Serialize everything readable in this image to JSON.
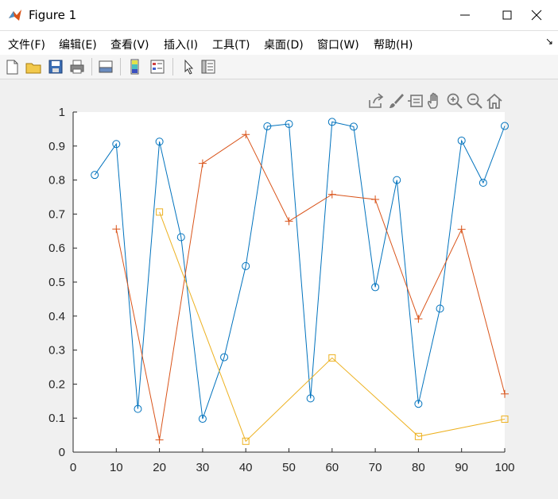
{
  "window": {
    "title": "Figure 1"
  },
  "menu": [
    "文件(F)",
    "编辑(E)",
    "查看(V)",
    "插入(I)",
    "工具(T)",
    "桌面(D)",
    "窗口(W)",
    "帮助(H)"
  ],
  "toolbar": [
    "new-figure-icon",
    "open-folder-icon",
    "save-icon",
    "print-icon",
    "link-plot-icon",
    "colorbar-icon",
    "legend-icon",
    "pointer-icon",
    "property-inspector-icon"
  ],
  "axes_toolbar": [
    "export-icon",
    "brush-icon",
    "data-tips-icon",
    "pan-icon",
    "zoom-in-icon",
    "zoom-out-icon",
    "home-icon"
  ],
  "colors": {
    "series1": "#0072BD",
    "series2": "#D95319",
    "series3": "#EDB120"
  },
  "chart_data": {
    "type": "line",
    "title": "",
    "xlabel": "",
    "ylabel": "",
    "xlim": [
      0,
      100
    ],
    "ylim": [
      0,
      1
    ],
    "xticks": [
      "0",
      "10",
      "20",
      "30",
      "40",
      "50",
      "60",
      "70",
      "80",
      "90",
      "100"
    ],
    "yticks": [
      "0",
      "0.1",
      "0.2",
      "0.3",
      "0.4",
      "0.5",
      "0.6",
      "0.7",
      "0.8",
      "0.9",
      "1"
    ],
    "grid": false,
    "series": [
      {
        "marker": "circle",
        "color": "#0072BD",
        "x": [
          5,
          10,
          15,
          20,
          25,
          30,
          35,
          40,
          45,
          50,
          55,
          60,
          65,
          70,
          75,
          80,
          85,
          90,
          95,
          100
        ],
        "y": [
          0.815,
          0.906,
          0.127,
          0.913,
          0.632,
          0.098,
          0.279,
          0.547,
          0.958,
          0.965,
          0.158,
          0.971,
          0.957,
          0.485,
          0.8,
          0.142,
          0.422,
          0.916,
          0.792,
          0.959
        ]
      },
      {
        "marker": "plus",
        "color": "#D95319",
        "x": [
          10,
          20,
          30,
          40,
          50,
          60,
          70,
          80,
          90,
          100
        ],
        "y": [
          0.656,
          0.036,
          0.849,
          0.934,
          0.679,
          0.758,
          0.743,
          0.392,
          0.655,
          0.171
        ]
      },
      {
        "marker": "square",
        "color": "#EDB120",
        "x": [
          20,
          40,
          60,
          80,
          100
        ],
        "y": [
          0.706,
          0.032,
          0.277,
          0.046,
          0.097
        ]
      }
    ]
  }
}
